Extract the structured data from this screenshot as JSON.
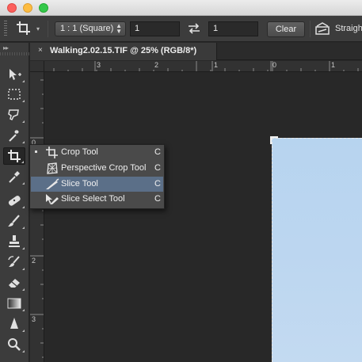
{
  "window": {
    "traffic_lights": [
      "close",
      "minimize",
      "zoom"
    ]
  },
  "options_bar": {
    "active_tool_icon": "crop-icon",
    "ratio_preset": "1 : 1 (Square)",
    "width_value": "1",
    "height_value": "1",
    "swap_icon": "swap-arrows-icon",
    "clear_label": "Clear",
    "straighten_label": "Straigh"
  },
  "toolbar": {
    "collapse_label": "▸▸",
    "tools": [
      {
        "name": "move-tool",
        "icon": "move-icon",
        "active": false
      },
      {
        "name": "marquee-tool",
        "icon": "marquee-icon",
        "active": false
      },
      {
        "name": "lasso-tool",
        "icon": "lasso-icon",
        "active": false
      },
      {
        "name": "magic-wand-tool",
        "icon": "magic-wand-icon",
        "active": false
      },
      {
        "name": "crop-tool",
        "icon": "crop-icon",
        "active": true
      },
      {
        "name": "eyedropper-tool",
        "icon": "eyedropper-icon",
        "active": false
      },
      {
        "name": "healing-brush-tool",
        "icon": "bandage-icon",
        "active": false
      },
      {
        "name": "brush-tool",
        "icon": "brush-icon",
        "active": false
      },
      {
        "name": "clone-stamp-tool",
        "icon": "stamp-icon",
        "active": false
      },
      {
        "name": "history-brush-tool",
        "icon": "history-brush-icon",
        "active": false
      },
      {
        "name": "eraser-tool",
        "icon": "eraser-icon",
        "active": false
      },
      {
        "name": "gradient-tool",
        "icon": "gradient-icon",
        "active": false
      },
      {
        "name": "sharpen-tool",
        "icon": "sharpen-icon",
        "active": false
      },
      {
        "name": "zoom-tool",
        "icon": "zoom-icon",
        "active": false
      }
    ]
  },
  "document": {
    "tab_title": "Walking2.02.15.TIF @ 25% (RGB/8*)",
    "close_glyph": "×"
  },
  "rulers": {
    "horizontal_labels": [
      "3",
      "2",
      "1",
      "0",
      "1"
    ],
    "vertical_labels": [
      "0",
      "1",
      "2",
      "3"
    ]
  },
  "flyout_menu": {
    "items": [
      {
        "label": "Crop Tool",
        "shortcut": "C",
        "icon": "crop-icon",
        "current": true,
        "highlighted": false
      },
      {
        "label": "Perspective Crop Tool",
        "shortcut": "C",
        "icon": "perspective-crop-icon",
        "current": false,
        "highlighted": false
      },
      {
        "label": "Slice Tool",
        "shortcut": "C",
        "icon": "slice-icon",
        "current": false,
        "highlighted": true
      },
      {
        "label": "Slice Select Tool",
        "shortcut": "C",
        "icon": "slice-select-icon",
        "current": false,
        "highlighted": false
      }
    ]
  },
  "colors": {
    "canvas_bg": "#282828",
    "panel_bg": "#3c3c3c",
    "menu_highlight": "#5b6f88",
    "image_fill": "#bcd6f0"
  }
}
